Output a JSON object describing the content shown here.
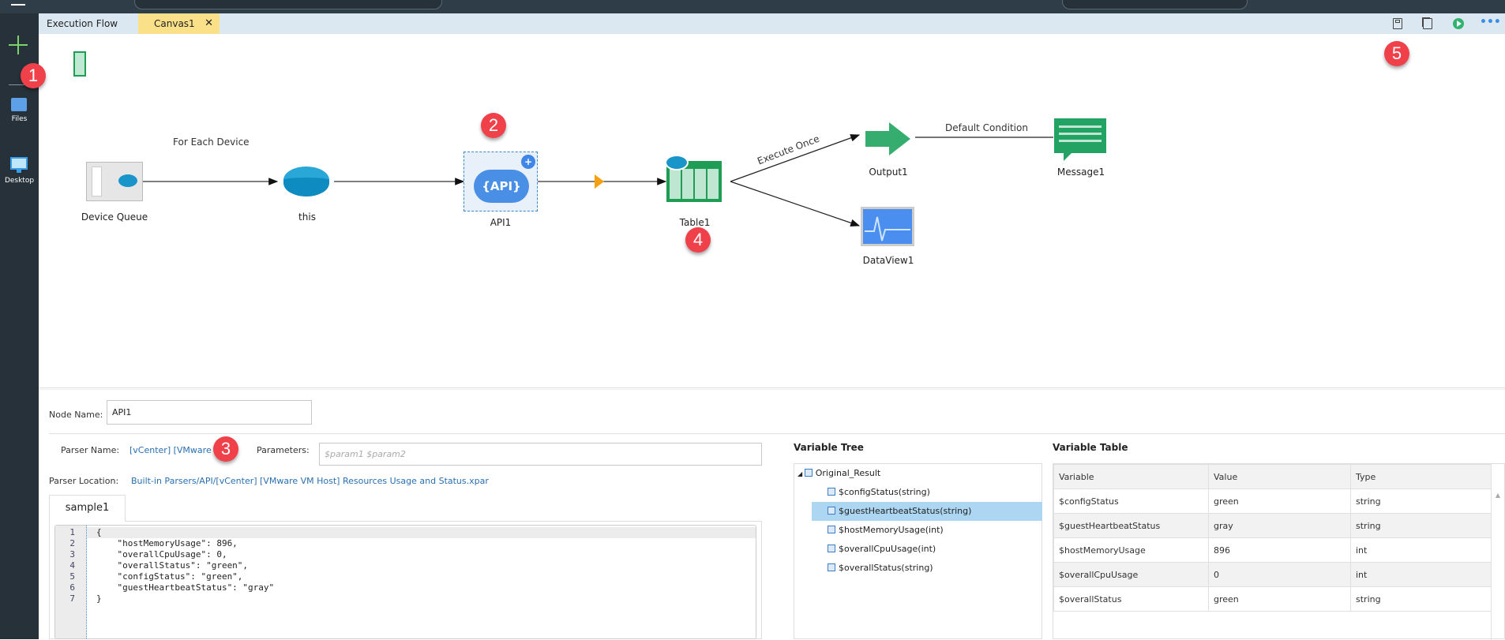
{
  "tabs": [
    {
      "label": "Execution Flow",
      "active": false
    },
    {
      "label": "Canvas1",
      "active": true
    }
  ],
  "sidebar": {
    "items": [
      {
        "label": "Files",
        "icon": "folder-icon"
      },
      {
        "label": "Desktop",
        "icon": "desktop-icon"
      }
    ]
  },
  "badges": [
    "1",
    "2",
    "3",
    "4",
    "5"
  ],
  "canvas": {
    "nodes": {
      "device_queue": "Device Queue",
      "this": "this",
      "api": "API1",
      "api_glyph": "{API}",
      "table": "Table1",
      "output": "Output1",
      "message": "Message1",
      "dataview": "DataView1"
    },
    "edges": {
      "for_each": "For Each Device",
      "execute_once": "Execute Once",
      "default_condition": "Default Condition"
    }
  },
  "panel": {
    "node_name_label": "Node Name:",
    "node_name_value": "API1",
    "parser_name_label": "Parser Name:",
    "parser_name_value": "[vCenter] [VMware",
    "parameters_label": "Parameters:",
    "parameters_placeholder": "$param1  $param2",
    "parser_location_label": "Parser Location:",
    "parser_location_value": "Built-in Parsers/API/[vCenter] [VMware VM Host] Resources Usage and Status.xpar",
    "sample_tab": "sample1",
    "code_lines": [
      "{",
      "    \"hostMemoryUsage\": 896,",
      "    \"overallCpuUsage\": 0,",
      "    \"overallStatus\": \"green\",",
      "    \"configStatus\": \"green\",",
      "    \"guestHeartbeatStatus\": \"gray\"",
      "}"
    ],
    "line_numbers": [
      "1",
      "2",
      "3",
      "4",
      "5",
      "6",
      "7"
    ]
  },
  "variable_tree": {
    "title": "Variable Tree",
    "root": "Original_Result",
    "items": [
      "$configStatus(string)",
      "$guestHeartbeatStatus(string)",
      "$hostMemoryUsage(int)",
      "$overallCpuUsage(int)",
      "$overallStatus(string)"
    ],
    "selected_index": 1
  },
  "variable_table": {
    "title": "Variable Table",
    "columns": [
      "Variable",
      "Value",
      "Type"
    ],
    "rows": [
      [
        "$configStatus",
        "green",
        "string"
      ],
      [
        "$guestHeartbeatStatus",
        "gray",
        "string"
      ],
      [
        "$hostMemoryUsage",
        "896",
        "int"
      ],
      [
        "$overallCpuUsage",
        "0",
        "int"
      ],
      [
        "$overallStatus",
        "green",
        "string"
      ]
    ]
  },
  "colors": {
    "accent": "#2a6fb0",
    "badge": "#f0414a",
    "tab_active": "#fbe08a",
    "selected_row": "#acd6f1",
    "green": "#22a36a"
  }
}
